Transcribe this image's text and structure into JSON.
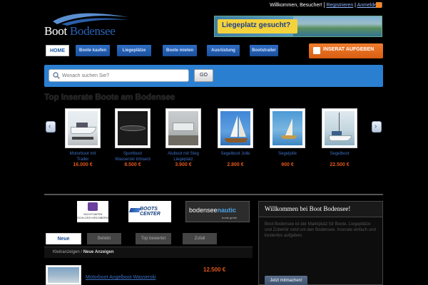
{
  "header": {
    "logo_word1": "Boot",
    "logo_word2": "Bodensee",
    "welcome_prefix": "Willkommen, Besucher! [",
    "register_link": "Registrieren",
    "separator": "|",
    "login_link": "Anmelden",
    "welcome_suffix": "]",
    "banner_text": "Liegeplatz gesucht?"
  },
  "nav": {
    "home_label": "HOME",
    "items": [
      "Boote kaufen",
      "Liegeplätze",
      "Boote mieten",
      "Ausrüstung",
      "Bootstrailer"
    ],
    "cta_label": "INSERAT AUFGEBEN"
  },
  "search": {
    "placeholder": "Wonach suchen Sie?",
    "go_label": "GO"
  },
  "top_section": {
    "title": "Top Inserate Boote am Bodensee",
    "boats": [
      {
        "name": "Motorboot mit Trailer",
        "price": "16.000 €"
      },
      {
        "name": "Sportboot Wasserski Inboard",
        "price": "8.500 €"
      },
      {
        "name": "Aluboot mit Steg Liegeplatz",
        "price": "3.900 €"
      },
      {
        "name": "Segelboot Jolle",
        "price": "2.800 €"
      },
      {
        "name": "Segeljolle",
        "price": "900 €"
      },
      {
        "name": "Segelboot",
        "price": "22.500 €"
      }
    ]
  },
  "partners": {
    "p1_text": "YACHTHAFEN SCHLOSS KIRCHBERG",
    "p2_text": "BOOTS CENTER",
    "p3_word1": "bodensee",
    "p3_word2": "nautic",
    "p3_sub": "boote gmbh"
  },
  "tabs": [
    "Neue Anzeigen",
    "Beliebt",
    "Top bewertet",
    "Zufall"
  ],
  "breadcrumb": {
    "root": "Kleinanzeigen",
    "sep": " / ",
    "current": "Neue Anzeigen"
  },
  "listing": {
    "title": "Motorboot Angelboot Wasserski",
    "price": "12.500 €"
  },
  "sidebar": {
    "title": "Willkommen bei Boot Bodensee!",
    "text": "Boot Bodensee ist der Marktplatz für Boote, Liegeplätze und Zubehör rund um den Bodensee. Inserate einfach und kostenlos aufgeben.",
    "button": "Jetzt mitmachen!"
  },
  "colors": {
    "accent_blue": "#2b7fd1",
    "accent_orange": "#e2561a",
    "link_blue": "#3d6fc2"
  }
}
